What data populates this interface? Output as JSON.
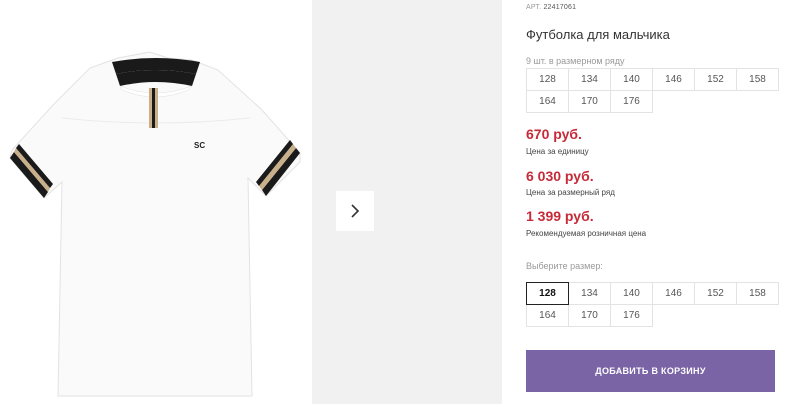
{
  "product": {
    "sku_label": "АРТ.",
    "sku_value": "22417061",
    "title": "Футболка для мальчика",
    "image_alt": "Белая футболка с черной окантовкой",
    "shirt_logo": "SC"
  },
  "gallery": {
    "next_icon": "chevron-right-icon"
  },
  "pack": {
    "note": "9 шт. в размерном ряду",
    "sizes": [
      "128",
      "134",
      "140",
      "146",
      "152",
      "158",
      "164",
      "170",
      "176"
    ]
  },
  "prices": {
    "unit_price": "670 руб.",
    "unit_label": "Цена за единицу",
    "pack_price": "6 030 руб.",
    "pack_label": "Цена за размерный ряд",
    "retail_price": "1 399 руб.",
    "retail_label": "Рекомендуемая розничная цена"
  },
  "size_select": {
    "label": "Выберите размер:",
    "selected": "128",
    "options": [
      "128",
      "134",
      "140",
      "146",
      "152",
      "158",
      "164",
      "170",
      "176"
    ]
  },
  "cart": {
    "add_label": "ДОБАВИТЬ В КОРЗИНУ"
  },
  "colors": {
    "price_red": "#c62a38",
    "button_purple": "#7a64a6",
    "gallery_gray": "#f1f1f1"
  }
}
